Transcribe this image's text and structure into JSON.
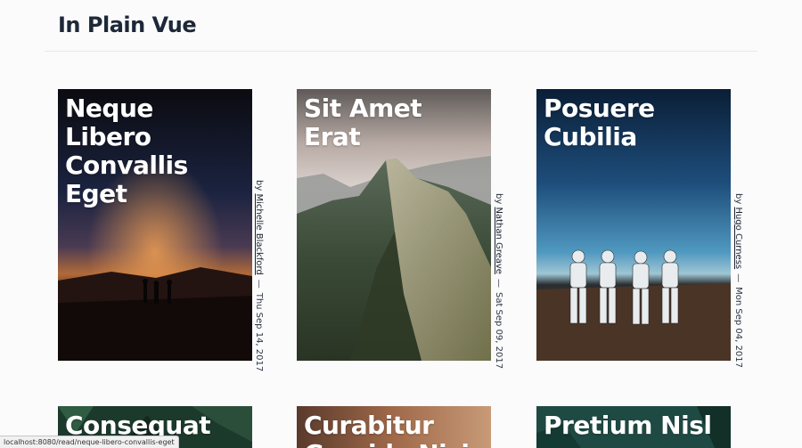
{
  "site": {
    "title": "In Plain Vue"
  },
  "posts": [
    {
      "title": "Neque Libero Convallis Eget",
      "by": "by",
      "author": "Michelle Blackford",
      "separator": "—",
      "date": "Thu Sep 14, 2017",
      "image_icon": "silhouette-sunset-image"
    },
    {
      "title": "Sit Amet Erat",
      "by": "by",
      "author": "Nathan Greave",
      "separator": "—",
      "date": "Sat Sep 09, 2017",
      "image_icon": "mountain-peak-image"
    },
    {
      "title": "Posuere Cubilia",
      "by": "by",
      "author": "Hugo Curness",
      "separator": "—",
      "date": "Mon Sep 04, 2017",
      "image_icon": "stormtroopers-image"
    },
    {
      "title": "Consequat",
      "image_icon": "jungle-image"
    },
    {
      "title": "Curabitur Gravida Nisi",
      "image_icon": "tower-image"
    },
    {
      "title": "Pretium Nisl",
      "image_icon": "palm-image"
    }
  ],
  "status_bar": {
    "url": "localhost:8080/read/neque-libero-convallis-eget"
  }
}
